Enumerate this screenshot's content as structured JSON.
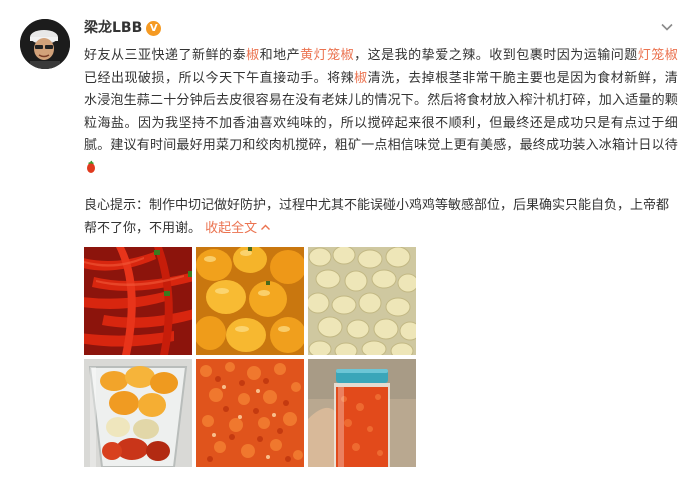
{
  "user": {
    "name": "梁龙LBB",
    "verified_badge": "V"
  },
  "post": {
    "p1_a": "好友从三亚快递了新鲜的泰",
    "p1_b": "椒",
    "p1_c": "和地产",
    "p1_d": "黄灯笼椒",
    "p1_e": "，这是我的挚爱之辣。收到包裹时因为运输问题",
    "p2_a": "灯笼椒",
    "p2_b": "已经出现破损，所以今天下午直接动手。将辣",
    "p2_c": "椒",
    "p2_d": "清洗，去掉根茎非常干脆主要也是因为食材新鲜，清水浸泡生蒜二十分钟后去皮很容易在没有老妹儿的情况下。然后将食材放入榨汁机打碎，加入适量的颗粒海盐。因为我坚持不加香油喜欢纯味的，所以搅碎起来很不顺利，但最终还是成功只是有点过于细腻。建议有时间最好用菜刀和绞肉机搅碎，粗矿一点相信味觉上更有美感，最终成功装入冰箱计日以待",
    "tip": "良心提示：制作中切记做好防护，过程中尤其不能误碰小鸡鸡等敏感部位，后果确实只能自负，上帝都帮不了你，不用谢。",
    "collapse_label": "收起全文",
    "collapse_icon": "chevron-up-icon"
  },
  "colors": {
    "link": "#eb7350",
    "text": "#333333",
    "badge": "#f59a23"
  },
  "photos": [
    {
      "subject": "red-chili-peppers"
    },
    {
      "subject": "yellow-lantern-peppers"
    },
    {
      "subject": "peeled-garlic-cloves"
    },
    {
      "subject": "peppers-in-blender"
    },
    {
      "subject": "chopped-chili-paste"
    },
    {
      "subject": "chili-paste-jar"
    }
  ]
}
